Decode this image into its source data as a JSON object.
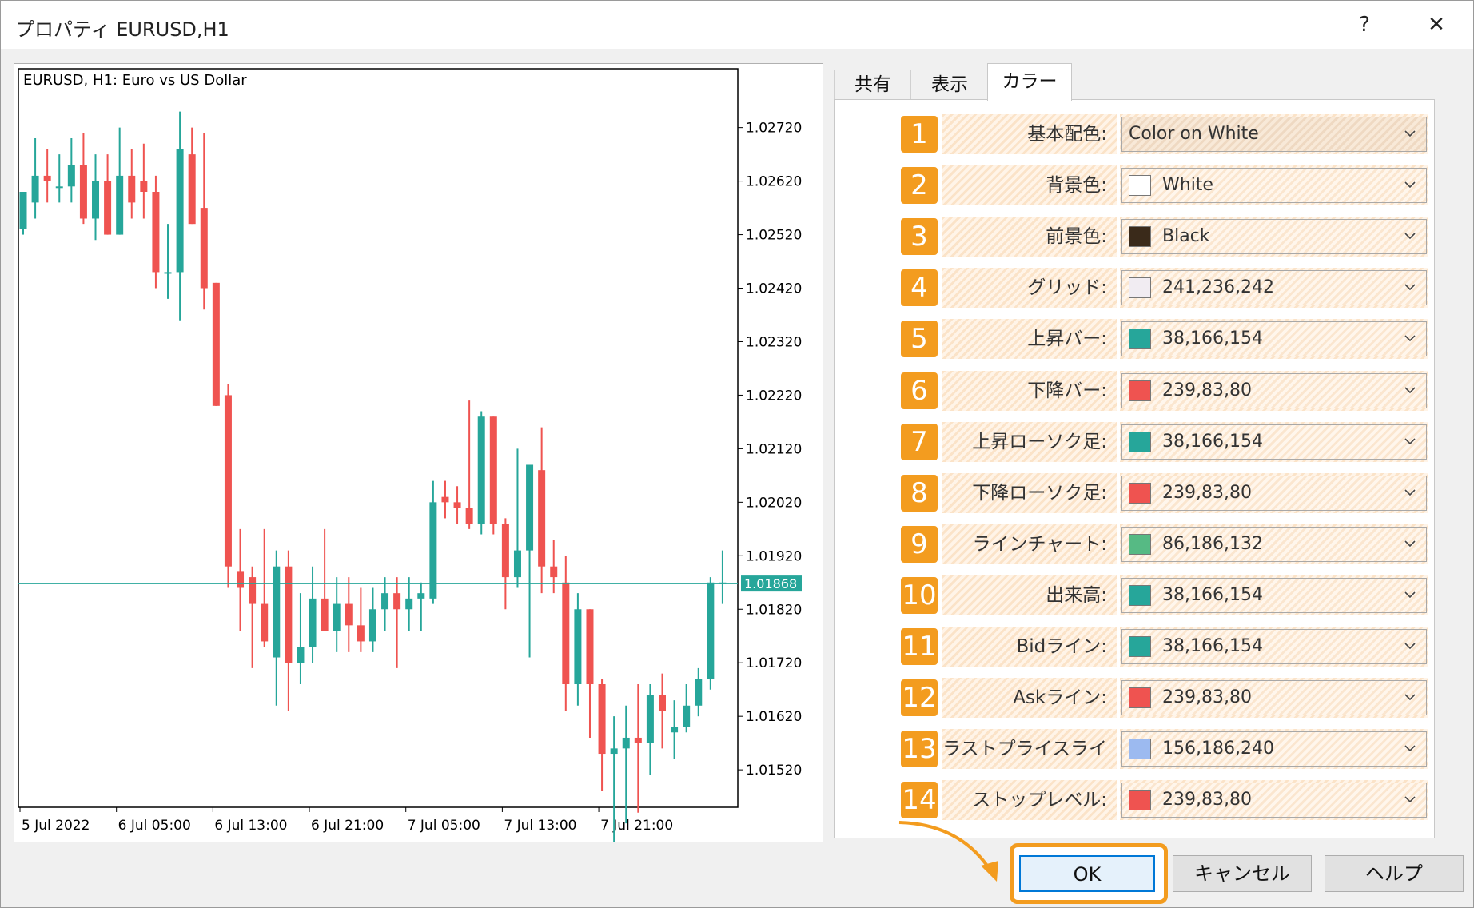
{
  "window": {
    "title": "プロパティ EURUSD,H1",
    "help_label": "?",
    "close_label": "✕"
  },
  "chart": {
    "title": "EURUSD, H1:  Euro vs US Dollar",
    "current_price": "1.01868",
    "bull_color": "#26a69a",
    "bear_color": "#ef5350"
  },
  "chart_data": {
    "type": "candlestick",
    "title": "EURUSD, H1:  Euro vs US Dollar",
    "symbol": "EURUSD",
    "timeframe": "H1",
    "y_ticks": [
      "1.02720",
      "1.02620",
      "1.02520",
      "1.02420",
      "1.02320",
      "1.02220",
      "1.02120",
      "1.02020",
      "1.01920",
      "1.01820",
      "1.01720",
      "1.01620",
      "1.01520"
    ],
    "x_ticks": [
      "5 Jul 2022",
      "6 Jul 05:00",
      "6 Jul 13:00",
      "6 Jul 21:00",
      "7 Jul 05:00",
      "7 Jul 13:00",
      "7 Jul 21:00"
    ],
    "ylim": [
      1.0145,
      1.0283
    ],
    "current_price": 1.01868,
    "grid": false,
    "candles": [
      {
        "o": 1.0253,
        "h": 1.026,
        "l": 1.0252,
        "c": 1.026
      },
      {
        "o": 1.0258,
        "h": 1.027,
        "l": 1.0255,
        "c": 1.0263
      },
      {
        "o": 1.0263,
        "h": 1.0268,
        "l": 1.0258,
        "c": 1.0262
      },
      {
        "o": 1.0261,
        "h": 1.0267,
        "l": 1.0258,
        "c": 1.0261
      },
      {
        "o": 1.0261,
        "h": 1.027,
        "l": 1.0258,
        "c": 1.0265
      },
      {
        "o": 1.0265,
        "h": 1.0271,
        "l": 1.0254,
        "c": 1.0255
      },
      {
        "o": 1.0255,
        "h": 1.0267,
        "l": 1.0251,
        "c": 1.0262
      },
      {
        "o": 1.0262,
        "h": 1.0267,
        "l": 1.0252,
        "c": 1.0252
      },
      {
        "o": 1.0252,
        "h": 1.0272,
        "l": 1.0257,
        "c": 1.0263
      },
      {
        "o": 1.0263,
        "h": 1.0268,
        "l": 1.0255,
        "c": 1.0258
      },
      {
        "o": 1.0262,
        "h": 1.0269,
        "l": 1.0255,
        "c": 1.026
      },
      {
        "o": 1.026,
        "h": 1.0263,
        "l": 1.0242,
        "c": 1.0245
      },
      {
        "o": 1.0245,
        "h": 1.0254,
        "l": 1.024,
        "c": 1.0245
      },
      {
        "o": 1.0245,
        "h": 1.0275,
        "l": 1.0236,
        "c": 1.0268
      },
      {
        "o": 1.0267,
        "h": 1.0272,
        "l": 1.0254,
        "c": 1.0254
      },
      {
        "o": 1.0257,
        "h": 1.0271,
        "l": 1.0238,
        "c": 1.0242
      },
      {
        "o": 1.0243,
        "h": 1.0235,
        "l": 1.022,
        "c": 1.022
      },
      {
        "o": 1.0222,
        "h": 1.0224,
        "l": 1.0186,
        "c": 1.019
      },
      {
        "o": 1.0189,
        "h": 1.0197,
        "l": 1.0178,
        "c": 1.0186
      },
      {
        "o": 1.0188,
        "h": 1.019,
        "l": 1.0171,
        "c": 1.0183
      },
      {
        "o": 1.0183,
        "h": 1.0197,
        "l": 1.0175,
        "c": 1.0176
      },
      {
        "o": 1.0173,
        "h": 1.0193,
        "l": 1.0164,
        "c": 1.019
      },
      {
        "o": 1.019,
        "h": 1.0193,
        "l": 1.0163,
        "c": 1.0172
      },
      {
        "o": 1.0172,
        "h": 1.0185,
        "l": 1.0168,
        "c": 1.0175
      },
      {
        "o": 1.0175,
        "h": 1.019,
        "l": 1.0172,
        "c": 1.0184
      },
      {
        "o": 1.0184,
        "h": 1.0197,
        "l": 1.0179,
        "c": 1.0178
      },
      {
        "o": 1.0178,
        "h": 1.0188,
        "l": 1.0174,
        "c": 1.0183
      },
      {
        "o": 1.0183,
        "h": 1.0188,
        "l": 1.0174,
        "c": 1.0179
      },
      {
        "o": 1.0179,
        "h": 1.0186,
        "l": 1.0174,
        "c": 1.0176
      },
      {
        "o": 1.0176,
        "h": 1.0186,
        "l": 1.0174,
        "c": 1.0182
      },
      {
        "o": 1.0182,
        "h": 1.0188,
        "l": 1.0178,
        "c": 1.0185
      },
      {
        "o": 1.0185,
        "h": 1.0188,
        "l": 1.0171,
        "c": 1.0182
      },
      {
        "o": 1.0182,
        "h": 1.0188,
        "l": 1.0178,
        "c": 1.0184
      },
      {
        "o": 1.0184,
        "h": 1.0187,
        "l": 1.0178,
        "c": 1.0185
      },
      {
        "o": 1.0184,
        "h": 1.0206,
        "l": 1.0183,
        "c": 1.0202
      },
      {
        "o": 1.0203,
        "h": 1.0206,
        "l": 1.0199,
        "c": 1.0202
      },
      {
        "o": 1.0202,
        "h": 1.0205,
        "l": 1.0198,
        "c": 1.0201
      },
      {
        "o": 1.0201,
        "h": 1.0221,
        "l": 1.0197,
        "c": 1.0198
      },
      {
        "o": 1.0198,
        "h": 1.0219,
        "l": 1.0196,
        "c": 1.0218
      },
      {
        "o": 1.0218,
        "h": 1.0218,
        "l": 1.0196,
        "c": 1.0198
      },
      {
        "o": 1.0198,
        "h": 1.0199,
        "l": 1.0182,
        "c": 1.0188
      },
      {
        "o": 1.0188,
        "h": 1.0212,
        "l": 1.0186,
        "c": 1.0193
      },
      {
        "o": 1.0193,
        "h": 1.0208,
        "l": 1.0173,
        "c": 1.0209
      },
      {
        "o": 1.0208,
        "h": 1.0216,
        "l": 1.0185,
        "c": 1.019
      },
      {
        "o": 1.019,
        "h": 1.0195,
        "l": 1.0185,
        "c": 1.0188
      },
      {
        "o": 1.0187,
        "h": 1.0192,
        "l": 1.0163,
        "c": 1.0168
      },
      {
        "o": 1.0168,
        "h": 1.0185,
        "l": 1.0164,
        "c": 1.0182
      },
      {
        "o": 1.0182,
        "h": 1.0182,
        "l": 1.0158,
        "c": 1.0168
      },
      {
        "o": 1.0168,
        "h": 1.0169,
        "l": 1.0148,
        "c": 1.0155
      },
      {
        "o": 1.0155,
        "h": 1.0162,
        "l": 1.0138,
        "c": 1.0156
      },
      {
        "o": 1.0156,
        "h": 1.0164,
        "l": 1.0142,
        "c": 1.0158
      },
      {
        "o": 1.0158,
        "h": 1.0168,
        "l": 1.0144,
        "c": 1.0157
      },
      {
        "o": 1.0157,
        "h": 1.0168,
        "l": 1.0151,
        "c": 1.0166
      },
      {
        "o": 1.0166,
        "h": 1.017,
        "l": 1.0156,
        "c": 1.0163
      },
      {
        "o": 1.0159,
        "h": 1.0165,
        "l": 1.0154,
        "c": 1.016
      },
      {
        "o": 1.016,
        "h": 1.0168,
        "l": 1.0159,
        "c": 1.0164
      },
      {
        "o": 1.0164,
        "h": 1.0171,
        "l": 1.0162,
        "c": 1.0169
      },
      {
        "o": 1.0169,
        "h": 1.0188,
        "l": 1.0167,
        "c": 1.0187
      },
      {
        "o": 1.0187,
        "h": 1.0193,
        "l": 1.0183,
        "c": 1.0187
      }
    ]
  },
  "tabs": [
    {
      "label": "共有",
      "active": false
    },
    {
      "label": "表示",
      "active": false
    },
    {
      "label": "カラー",
      "active": true
    }
  ],
  "color_settings": [
    {
      "num": "1",
      "label": "基本配色:",
      "value": "Color on White",
      "color": ""
    },
    {
      "num": "2",
      "label": "背景色:",
      "value": "White",
      "color": "#ffffff"
    },
    {
      "num": "3",
      "label": "前景色:",
      "value": "Black",
      "color": "#3a2a1a"
    },
    {
      "num": "4",
      "label": "グリッド:",
      "value": "241,236,242",
      "color": "#f1ecf2"
    },
    {
      "num": "5",
      "label": "上昇バー:",
      "value": "38,166,154",
      "color": "#26a69a"
    },
    {
      "num": "6",
      "label": "下降バー:",
      "value": "239,83,80",
      "color": "#ef5350"
    },
    {
      "num": "7",
      "label": "上昇ローソク足:",
      "value": "38,166,154",
      "color": "#26a69a"
    },
    {
      "num": "8",
      "label": "下降ローソク足:",
      "value": "239,83,80",
      "color": "#ef5350"
    },
    {
      "num": "9",
      "label": "ラインチャート:",
      "value": "86,186,132",
      "color": "#56ba84"
    },
    {
      "num": "10",
      "label": "出来高:",
      "value": "38,166,154",
      "color": "#26a69a"
    },
    {
      "num": "11",
      "label": "Bidライン:",
      "value": "38,166,154",
      "color": "#26a69a"
    },
    {
      "num": "12",
      "label": "Askライン:",
      "value": "239,83,80",
      "color": "#ef5350"
    },
    {
      "num": "13",
      "label": "ラストプライスライン:",
      "value": "156,186,240",
      "color": "#9cbaf0"
    },
    {
      "num": "14",
      "label": "ストップレベル:",
      "value": "239,83,80",
      "color": "#ef5350"
    }
  ],
  "buttons": {
    "ok": "OK",
    "cancel": "キャンセル",
    "help": "ヘルプ"
  },
  "colors": {
    "accent_orange": "#f39c1f",
    "ok_border": "#0078d7"
  }
}
